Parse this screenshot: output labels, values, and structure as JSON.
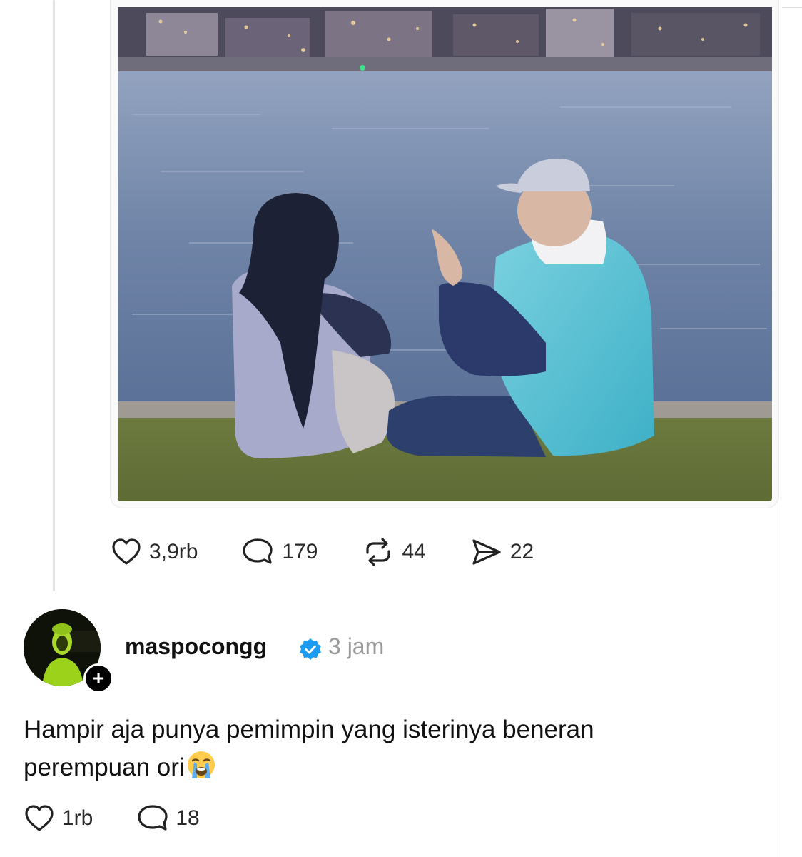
{
  "post": {
    "stats": {
      "likes": "3,9rb",
      "replies": "179",
      "reposts": "44",
      "shares": "22"
    },
    "icons": {
      "like": "heart-icon",
      "reply": "comment-icon",
      "repost": "repost-icon",
      "share": "send-icon"
    }
  },
  "reply": {
    "username": "maspocongg",
    "verified_icon": "verified-badge-icon",
    "time": "3 jam",
    "follow_symbol": "+",
    "text_line1": "Hampir aja punya pemimpin yang isterinya beneran",
    "text_line2": "perempuan ori",
    "emoji": "loudly-crying-face",
    "stats": {
      "likes": "1rb",
      "replies": "18"
    }
  },
  "colors": {
    "background": "#ffffff",
    "text": "#111111",
    "muted": "#9a9a9a",
    "verified": "#1d9bf0",
    "thread_line": "#e3e3e3"
  }
}
